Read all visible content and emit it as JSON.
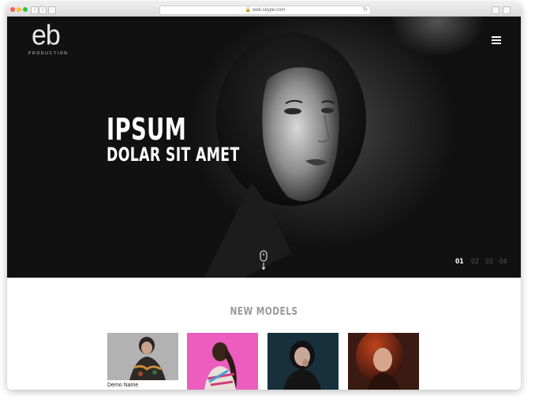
{
  "browser": {
    "url": "web.skype.com",
    "back_icon": "chevron-left-icon",
    "forward_icon": "chevron-right-icon",
    "reload_icon": "reload-icon"
  },
  "hero": {
    "logo_mark": "eb",
    "logo_sub": "PRODUCTION",
    "menu_icon": "hamburger-icon",
    "title_line1": "IPSUM",
    "title_line2": "DOLAR SIT AMET",
    "scroll_icon": "mouse-scroll-icon",
    "pages": [
      "01",
      "02",
      "03",
      "04"
    ],
    "active_page": "01"
  },
  "models": {
    "title": "NEW MODELS",
    "cards": [
      {
        "name": "Demo Name",
        "bg": "#8a8a8a"
      },
      {
        "name": "",
        "bg": "#e44fb7"
      },
      {
        "name": "",
        "bg": "#1e3a48"
      },
      {
        "name": "",
        "bg": "#3a1a12"
      }
    ]
  },
  "colors": {
    "hero_bg": "#111111",
    "accent": "#ffffff",
    "muted": "#9a9a9a"
  }
}
